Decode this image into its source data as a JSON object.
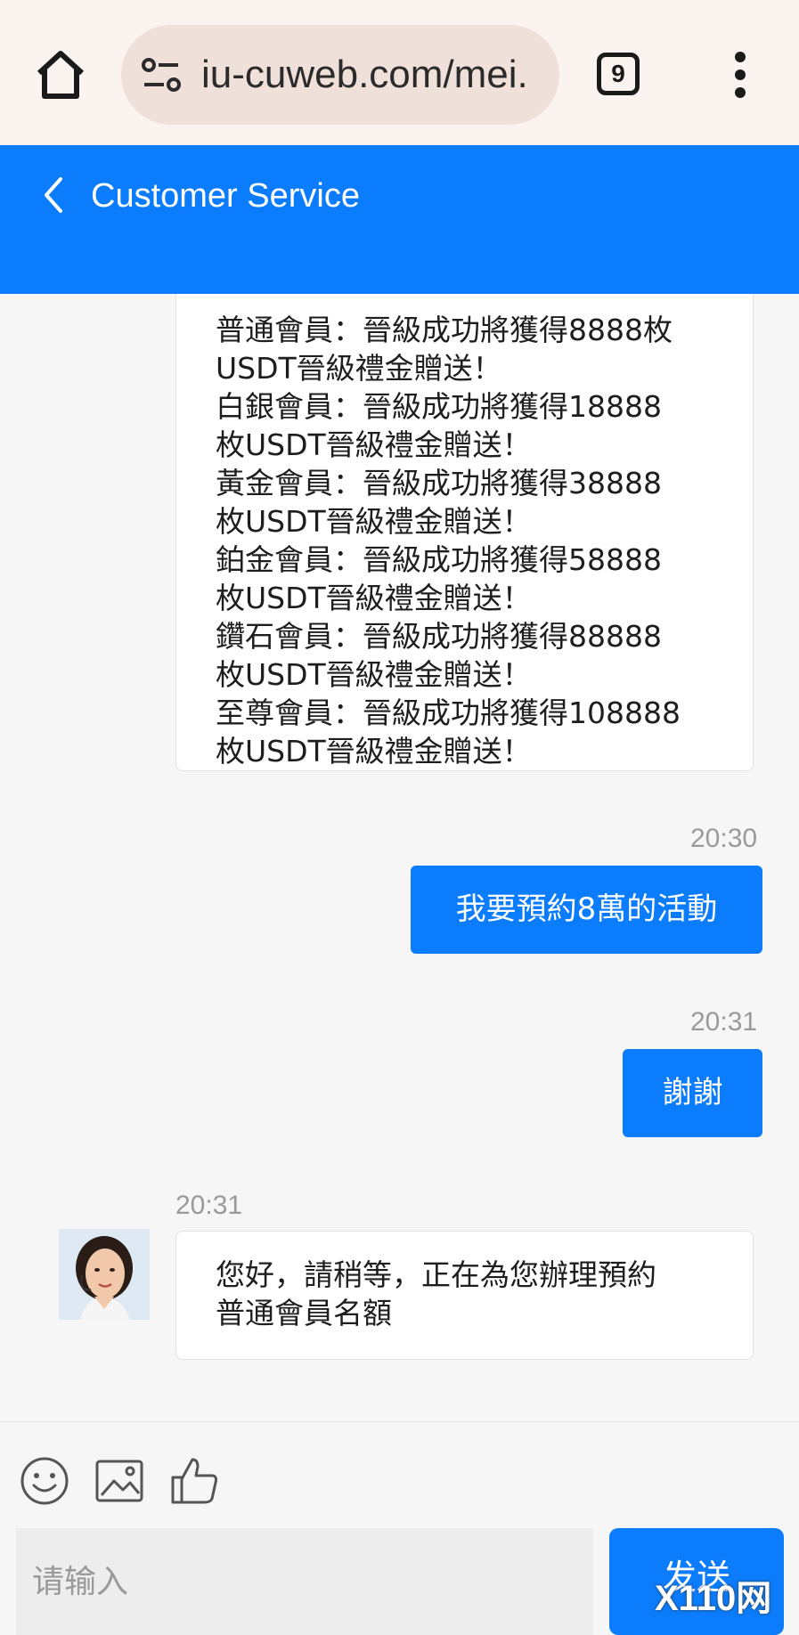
{
  "browser": {
    "url": "iu-cuweb.com/mei.",
    "tab_count": "9"
  },
  "header": {
    "title": "Customer Service"
  },
  "messages": [
    {
      "side": "left",
      "lines": [
        "普通會員：晉級成功將獲得8888枚",
        "USDT晉級禮金贈送！",
        "白銀會員：晉級成功將獲得18888",
        "枚USDT晉級禮金贈送！",
        "黃金會員：晉級成功將獲得38888",
        "枚USDT晉級禮金贈送！",
        "鉑金會員：晉級成功將獲得58888",
        "枚USDT晉級禮金贈送！",
        "鑽石會員：晉級成功將獲得88888",
        "枚USDT晉級禮金贈送！",
        "至尊會員：晉級成功將獲得108888",
        "枚USDT晉級禮金贈送！"
      ]
    },
    {
      "side": "right",
      "time": "20:30",
      "text": "我要預約8萬的活動"
    },
    {
      "side": "right",
      "time": "20:31",
      "text": "謝謝"
    },
    {
      "side": "left",
      "time": "20:31",
      "lines": [
        "您好，請稍等，正在為您辦理預約",
        "普通會員名額"
      ]
    }
  ],
  "composer": {
    "placeholder": "请输入",
    "send_label": "发送"
  },
  "watermark": "X110网",
  "colors": {
    "accent": "#0b7cfb",
    "browser_bar": "#fbf3f0"
  },
  "icons": [
    "home-icon",
    "site-settings-icon",
    "tabs-icon",
    "more-vert-icon",
    "back-icon",
    "emoji-icon",
    "image-icon",
    "thumbs-up-icon",
    "agent-avatar"
  ]
}
